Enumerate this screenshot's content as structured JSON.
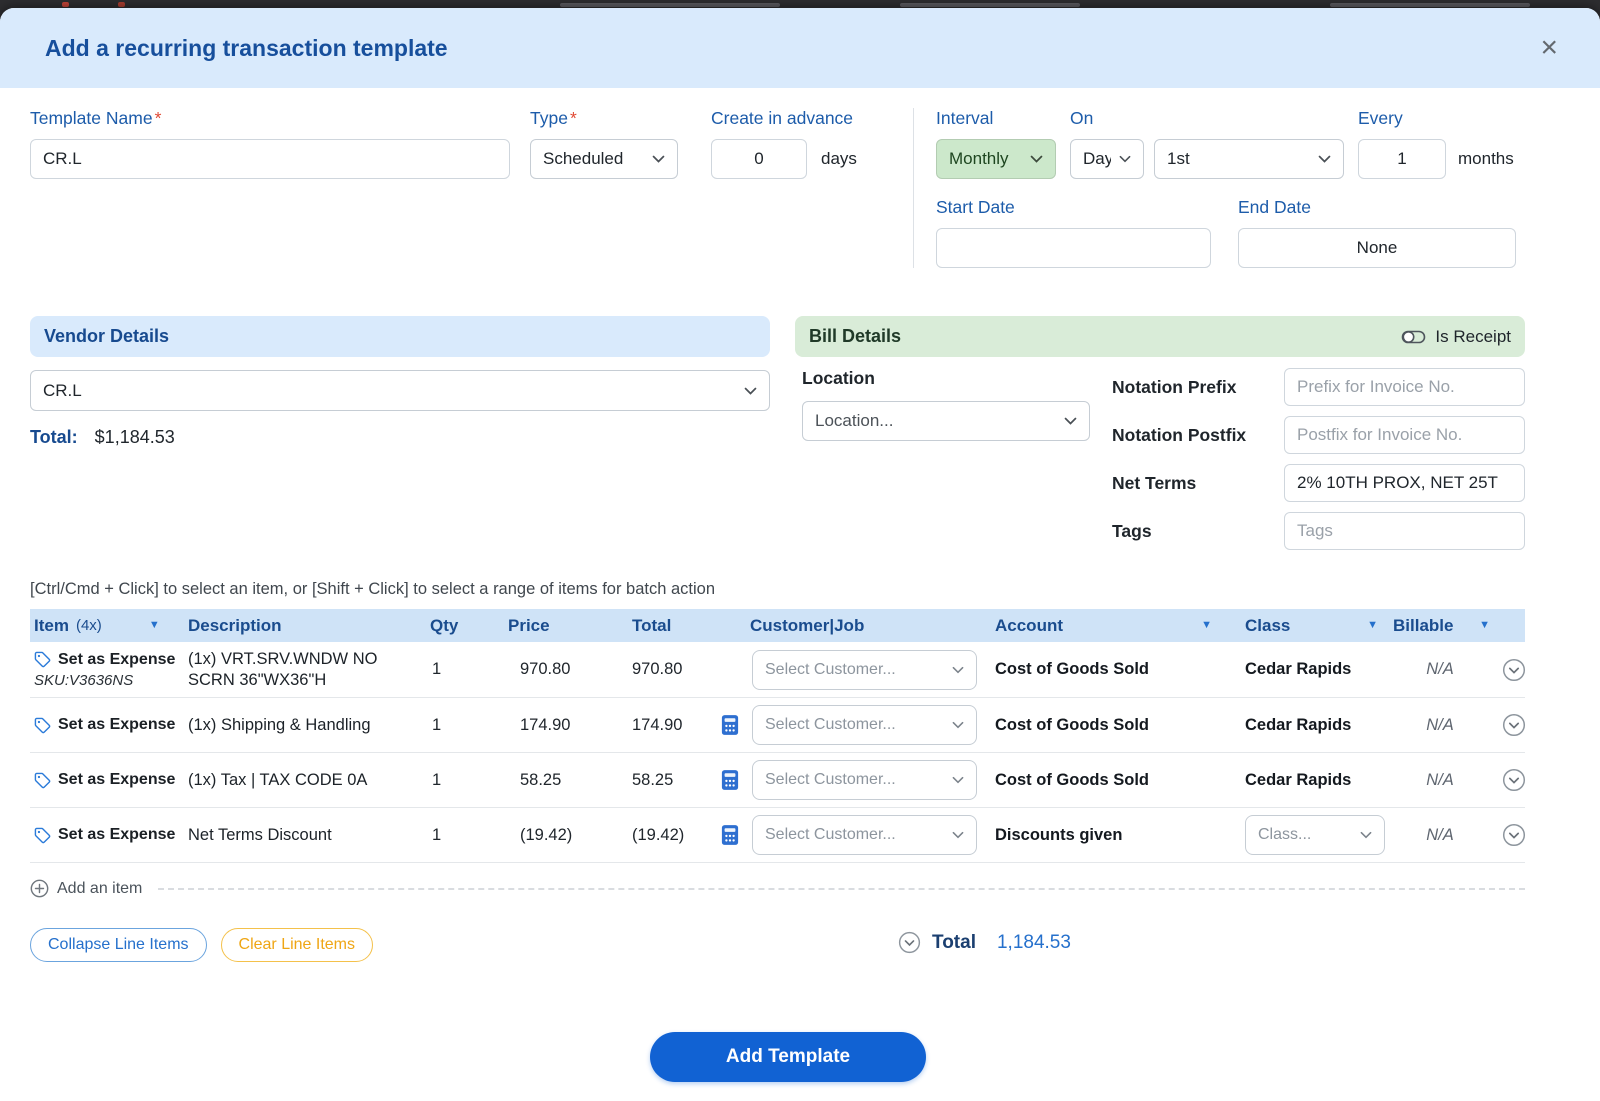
{
  "modal": {
    "title": "Add a recurring transaction template",
    "close": "×"
  },
  "form": {
    "template_name_label": "Template Name",
    "required_mark": "*",
    "template_name_value": "CR.L",
    "type_label": "Type",
    "type_value": "Scheduled",
    "create_in_advance_label": "Create in advance",
    "create_in_advance_value": "0",
    "days_suffix": "days",
    "interval_label": "Interval",
    "interval_value": "Monthly",
    "on_label": "On",
    "on_day_value": "Day",
    "on_ordinal_value": "1st",
    "every_label": "Every",
    "every_value": "1",
    "months_suffix": "months",
    "start_date_label": "Start Date",
    "end_date_label": "End Date",
    "end_date_value": "None"
  },
  "vendor": {
    "title": "Vendor Details",
    "value": "CR.L",
    "total_label": "Total:",
    "total_value": "$1,184.53"
  },
  "bill": {
    "title": "Bill Details",
    "is_receipt": "Is Receipt",
    "location_label": "Location",
    "location_value": "Location...",
    "notation_prefix_label": "Notation Prefix",
    "notation_prefix_placeholder": "Prefix for Invoice No.",
    "notation_postfix_label": "Notation Postfix",
    "notation_postfix_placeholder": "Postfix for Invoice No.",
    "net_terms_label": "Net Terms",
    "net_terms_value": "2% 10TH PROX, NET 25T",
    "tags_label": "Tags",
    "tags_placeholder": "Tags"
  },
  "items": {
    "hint": "[Ctrl/Cmd + Click] to select an item, or [Shift + Click] to select a range of items for batch action",
    "header": {
      "item": "Item",
      "item_count": "(4x)",
      "description": "Description",
      "qty": "Qty",
      "price": "Price",
      "total": "Total",
      "customer_job": "Customer|Job",
      "account": "Account",
      "class": "Class",
      "billable": "Billable"
    },
    "rows": [
      {
        "badge": "Set as Expense",
        "sku": "SKU:V3636NS",
        "description": "(1x) VRT.SRV.WNDW NO SCRN 36\"WX36\"H",
        "qty": "1",
        "price": "970.80",
        "total": "970.80",
        "customer_placeholder": "Select Customer...",
        "account": "Cost of Goods Sold",
        "class": "Cedar Rapids",
        "billable": "N/A"
      },
      {
        "badge": "Set as Expense",
        "description": "(1x) Shipping & Handling",
        "qty": "1",
        "price": "174.90",
        "total": "174.90",
        "customer_placeholder": "Select Customer...",
        "account": "Cost of Goods Sold",
        "class": "Cedar Rapids",
        "billable": "N/A"
      },
      {
        "badge": "Set as Expense",
        "description": "(1x) Tax | TAX CODE 0A",
        "qty": "1",
        "price": "58.25",
        "total": "58.25",
        "customer_placeholder": "Select Customer...",
        "account": "Cost of Goods Sold",
        "class": "Cedar Rapids",
        "billable": "N/A"
      },
      {
        "badge": "Set as Expense",
        "description": "Net Terms Discount",
        "qty": "1",
        "price": "(19.42)",
        "total": "(19.42)",
        "customer_placeholder": "Select Customer...",
        "account": "Discounts given",
        "class_select": "Class...",
        "billable": "N/A"
      }
    ],
    "add_item": "Add an item"
  },
  "footer": {
    "collapse_button": "Collapse Line Items",
    "clear_button": "Clear Line Items",
    "total_label": "Total",
    "total_value": "1,184.53",
    "add_template_button": "Add Template"
  },
  "colors": {
    "header_bg": "#d9eafc",
    "title_blue": "#174f9c",
    "label_blue": "#1d5caa",
    "interval_green_bg": "#cce8cb",
    "table_header_bg": "#cfe3f7",
    "accent_blue": "#2570cc",
    "clear_orange": "#efa615",
    "primary_button_blue": "#1162d3"
  }
}
